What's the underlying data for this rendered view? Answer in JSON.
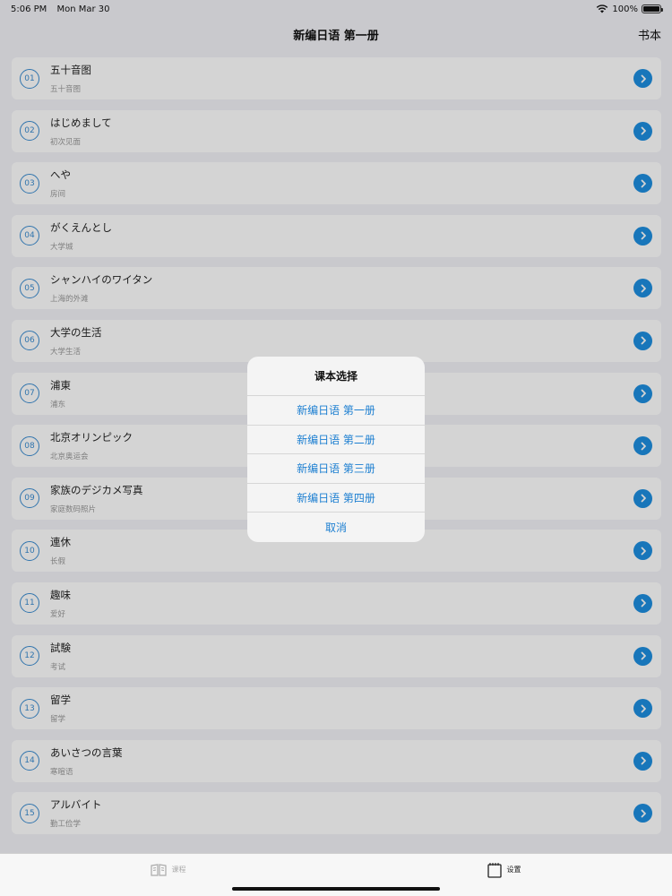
{
  "status_bar": {
    "time": "5:06 PM",
    "date": "Mon Mar 30",
    "battery": "100%"
  },
  "nav": {
    "title": "新编日语 第一册",
    "right_button": "书本"
  },
  "lessons": [
    {
      "num": "01",
      "title": "五十音图",
      "subtitle": "五十音图"
    },
    {
      "num": "02",
      "title": "はじめまして",
      "subtitle": "初次见面"
    },
    {
      "num": "03",
      "title": "へや",
      "subtitle": "房间"
    },
    {
      "num": "04",
      "title": "がくえんとし",
      "subtitle": "大学城"
    },
    {
      "num": "05",
      "title": "シャンハイのワイタン",
      "subtitle": "上海的外滩"
    },
    {
      "num": "06",
      "title": "大学の生活",
      "subtitle": "大学生活"
    },
    {
      "num": "07",
      "title": "浦東",
      "subtitle": "浦东"
    },
    {
      "num": "08",
      "title": "北京オリンピック",
      "subtitle": "北京奥运会"
    },
    {
      "num": "09",
      "title": "家族のデジカメ写真",
      "subtitle": "家庭数码照片"
    },
    {
      "num": "10",
      "title": "連休",
      "subtitle": "长假"
    },
    {
      "num": "11",
      "title": "趣味",
      "subtitle": "爱好"
    },
    {
      "num": "12",
      "title": "試験",
      "subtitle": "考试"
    },
    {
      "num": "13",
      "title": "留学",
      "subtitle": "留学"
    },
    {
      "num": "14",
      "title": "あいさつの言葉",
      "subtitle": "寒暄语"
    },
    {
      "num": "15",
      "title": "アルバイト",
      "subtitle": "勤工俭学"
    }
  ],
  "dialog": {
    "title": "课本选择",
    "options": [
      "新编日语 第一册",
      "新编日语 第二册",
      "新编日语 第三册",
      "新编日语 第四册"
    ],
    "cancel": "取消"
  },
  "tabs": [
    {
      "label": "课程",
      "icon": "book-icon",
      "active": false
    },
    {
      "label": "设置",
      "icon": "notepad-icon",
      "active": true
    }
  ],
  "colors": {
    "accent": "#1d8fe0",
    "dialog_text": "#1d7fd1"
  }
}
